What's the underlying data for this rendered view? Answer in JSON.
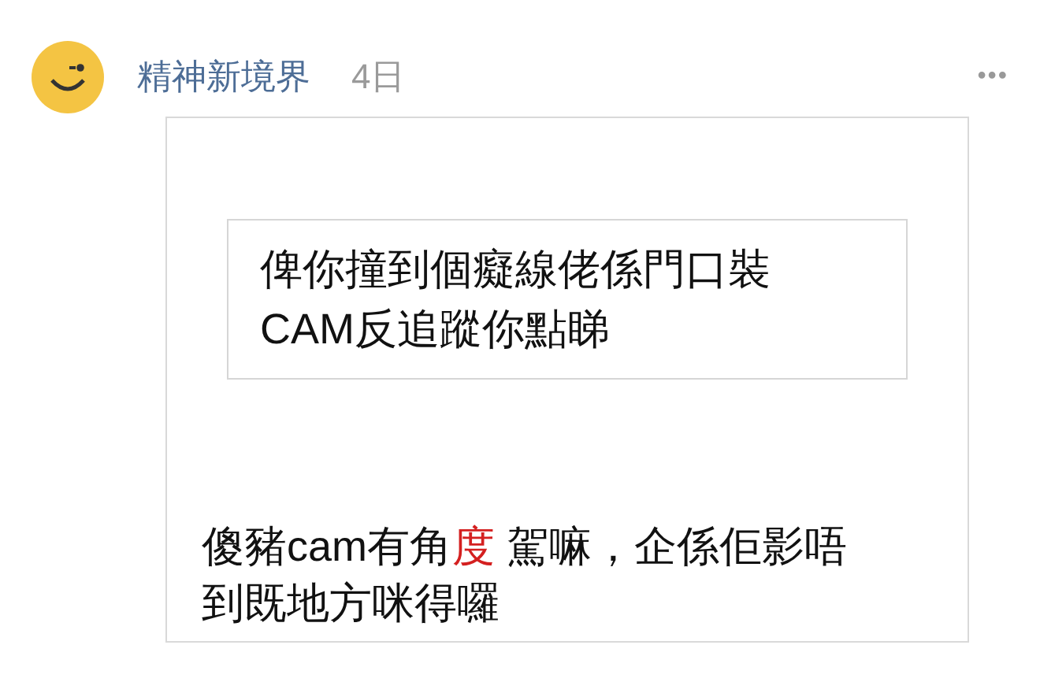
{
  "post": {
    "author": "精神新境界",
    "time": "4日",
    "more": "•••"
  },
  "image": {
    "quote_lines": [
      "俾你撞到個癡線佬係門口裝",
      "CAM反追蹤你點睇"
    ],
    "reply_lines": [
      [
        {
          "text": "傻豬cam有角",
          "highlight": false
        },
        {
          "text": "度",
          "highlight": true
        },
        {
          "text": " 駕嘛，企係佢影唔",
          "highlight": false
        }
      ],
      [
        {
          "text": "到既地方咪得囉",
          "highlight": false
        }
      ]
    ]
  }
}
